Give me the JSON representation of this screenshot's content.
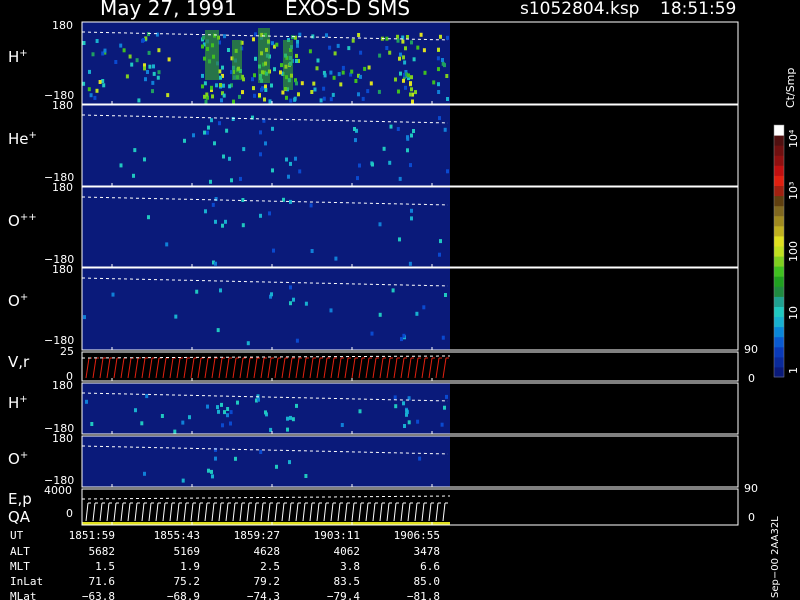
{
  "header": {
    "date": "May 27, 1991",
    "instrument": "EXOS-D SMS",
    "file": "s1052804.ksp",
    "time": "18:51:59"
  },
  "panels": [
    {
      "key": "h1",
      "label": "H",
      "sup": "+",
      "top": "180",
      "bottom": "−180"
    },
    {
      "key": "he",
      "label": "He",
      "sup": "+",
      "top": "180",
      "bottom": "−180"
    },
    {
      "key": "o2",
      "label": "O",
      "sup": "++",
      "top": "180",
      "bottom": "−180"
    },
    {
      "key": "o1",
      "label": "O",
      "sup": "+",
      "top": "180",
      "bottom": "−180"
    },
    {
      "key": "vr",
      "label": "V,r",
      "sup": "",
      "top": "25",
      "bottom": "0",
      "right_top": "90",
      "right_bottom": "0"
    },
    {
      "key": "h2",
      "label": "H",
      "sup": "+",
      "top": "180",
      "bottom": "−180"
    },
    {
      "key": "o3",
      "label": "O",
      "sup": "+",
      "top": "180",
      "bottom": "−180"
    },
    {
      "key": "ep",
      "label": "E,p",
      "sup": "",
      "label2": "QA",
      "top": "4000",
      "bottom": "0",
      "right_top": "90",
      "right_bottom": "0"
    }
  ],
  "colorbar": {
    "unit": "Ct/Smp",
    "ticks": [
      "1",
      "10",
      "100",
      "10³",
      "10⁴"
    ],
    "colors": [
      "#0a1a7a",
      "#0a2a9a",
      "#0a3ab8",
      "#0a5ad0",
      "#0a86d8",
      "#18b0d0",
      "#20c8c0",
      "#20a090",
      "#208a40",
      "#20a020",
      "#40c020",
      "#80d020",
      "#c0e020",
      "#e0e020",
      "#c0b020",
      "#a08a20",
      "#806820",
      "#604010",
      "#a02010",
      "#e02010",
      "#c01010",
      "#901010",
      "#701010",
      "#501010",
      "#ffffff"
    ]
  },
  "footer": {
    "side_label": "Sep−00 2AA32L",
    "rows": [
      {
        "label": "UT",
        "values": [
          "1851:59",
          "1855:43",
          "1859:27",
          "1903:11",
          "1906:55"
        ]
      },
      {
        "label": "ALT",
        "values": [
          "5682",
          "5169",
          "4628",
          "4062",
          "3478"
        ]
      },
      {
        "label": "MLT",
        "values": [
          "1.5",
          "1.9",
          "2.5",
          "3.8",
          "6.6"
        ]
      },
      {
        "label": "InLat",
        "values": [
          "71.6",
          "75.2",
          "79.2",
          "83.5",
          "85.0"
        ]
      },
      {
        "label": "MLat",
        "values": [
          "−63.8",
          "−68.9",
          "−74.3",
          "−79.4",
          "−81.8"
        ]
      }
    ]
  },
  "chart_data": {
    "type": "heatmap",
    "x_ticks_ut": [
      "1851:59",
      "1855:43",
      "1859:27",
      "1903:11",
      "1906:55"
    ],
    "y_range_pitch_angle": [
      -180,
      180
    ],
    "panels": [
      "H+",
      "He+",
      "O++",
      "O+",
      "V,r",
      "H+",
      "O+",
      "E,p QA"
    ],
    "colorbar_range_counts": [
      1,
      10000
    ],
    "colorbar_scale": "log",
    "data_coverage": "partial (first ~57% of interval)"
  }
}
